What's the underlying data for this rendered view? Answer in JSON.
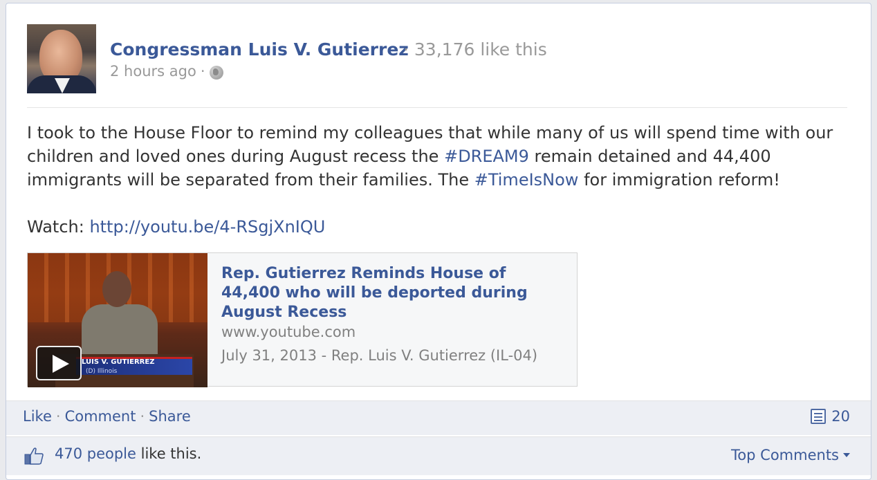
{
  "post": {
    "page_name": "Congressman Luis V. Gutierrez",
    "likes_count": "33,176 like this",
    "time": "2 hours ago",
    "message_parts": {
      "p1": "I took to the House Floor to remind my colleagues that while many of us will spend time with our children and loved ones during August recess the ",
      "hashtag1": "#DREAM9",
      "p2": " remain detained and 44,400 immigrants will be separated from their families. The ",
      "hashtag2": "#TimeIsNow",
      "p3": " for immigration reform!"
    },
    "watch_label": "Watch: ",
    "watch_link": "http://youtu.be/4-RSgjXnIQU"
  },
  "attachment": {
    "title": "Rep. Gutierrez Reminds House of 44,400 who will be deported during August Recess",
    "domain": "www.youtube.com",
    "description": "July 31, 2013 - Rep. Luis V. Gutierrez (IL-04)",
    "thumb_caption": "LUIS V. GUTIERREZ",
    "thumb_subcaption": "(D) Illinois"
  },
  "actions": {
    "like": "Like",
    "comment": "Comment",
    "share": "Share",
    "separator": "·",
    "comment_count": "20"
  },
  "likes": {
    "people_link": "470 people",
    "suffix": " like this.",
    "top_comments": "Top Comments"
  },
  "colors": {
    "link": "#3b5998",
    "muted": "#999999",
    "footer_bg": "#edeff4"
  }
}
